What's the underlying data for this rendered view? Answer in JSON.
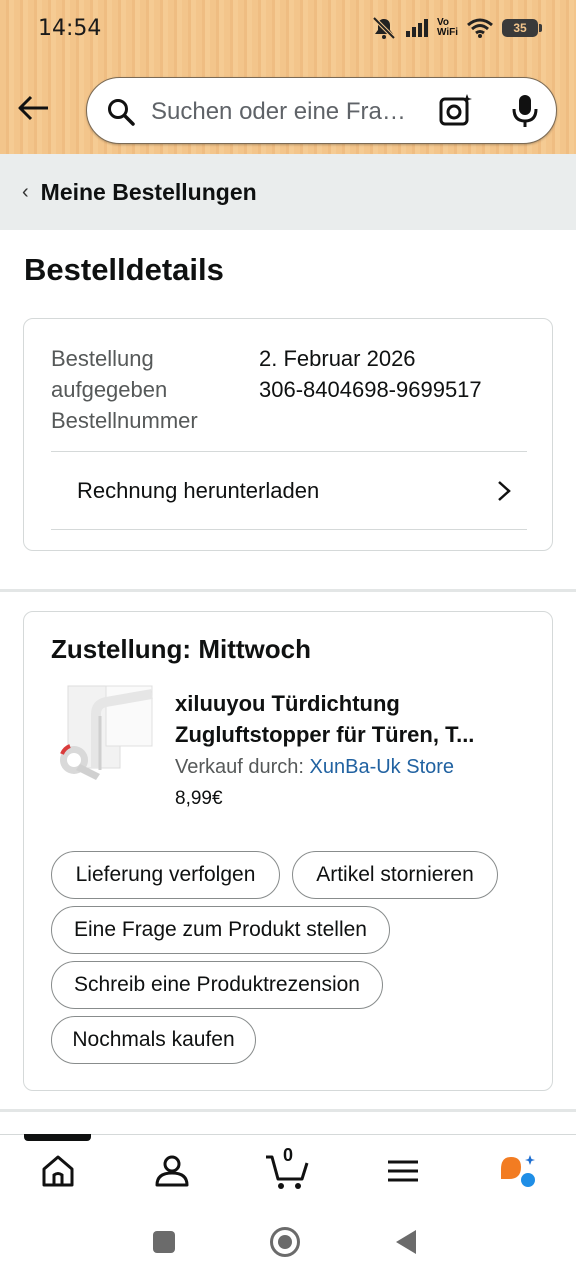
{
  "status_bar": {
    "time": "14:54",
    "network_label_top": "Vo",
    "network_label_bottom": "WiFi",
    "battery": "35",
    "icons": [
      "mute-icon",
      "signal-icon",
      "vowifi-icon",
      "wifi-icon",
      "battery-icon"
    ]
  },
  "search": {
    "placeholder": "Suchen oder eine Frage stellen",
    "icons": [
      "back-arrow-icon",
      "search-icon",
      "camera-icon",
      "mic-icon"
    ]
  },
  "breadcrumb": {
    "label": "Meine Bestellungen"
  },
  "page": {
    "title": "Bestelldetails"
  },
  "order_info": {
    "placed_label": "Bestellung aufgegeben",
    "placed_value": "2. Februar 2026",
    "number_label": "Bestellnummer",
    "number_value": "306-8404698-9699517",
    "invoice_label": "Rechnung herunterladen"
  },
  "shipment": {
    "title": "Zustellung: Mittwoch",
    "product_title_line1": "xiluuyou Türdichtung",
    "product_title_line2": "Zugluftstopper für Türen, T...",
    "sold_by_label": "Verkauf durch:",
    "seller": "XunBa-Uk Store",
    "price": "8,99€",
    "buttons": {
      "track": "Lieferung verfolgen",
      "cancel": "Artikel stornieren",
      "ask": "Eine Frage zum Produkt stellen",
      "review": "Schreib eine Produktrezension",
      "buy_again": "Nochmals kaufen"
    }
  },
  "tabbar": {
    "cart_count": "0",
    "tabs": [
      "home-icon",
      "account-icon",
      "cart-icon",
      "menu-icon",
      "rufus-icon"
    ],
    "active_tab": "home"
  },
  "colors": {
    "header_bg": "#f3c58b",
    "link": "#2162a1",
    "subnav_bg": "#eaeded",
    "border": "#d5d9d9"
  }
}
